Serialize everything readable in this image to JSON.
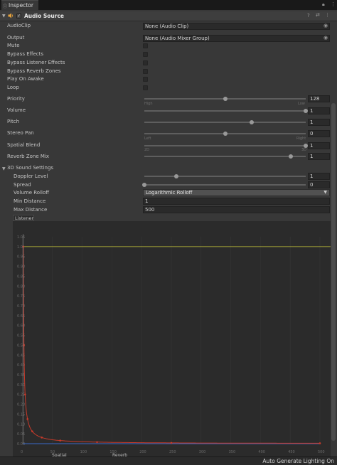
{
  "window": {
    "tab_title": "Inspector"
  },
  "component": {
    "title": "Audio Source",
    "enabled": true
  },
  "fields": {
    "audio_clip": {
      "label": "AudioClip",
      "value": "None (Audio Clip)"
    },
    "output": {
      "label": "Output",
      "value": "None (Audio Mixer Group)"
    },
    "mute": {
      "label": "Mute",
      "checked": false
    },
    "bypass_effects": {
      "label": "Bypass Effects",
      "checked": false
    },
    "bypass_listener_effects": {
      "label": "Bypass Listener Effects",
      "checked": false
    },
    "bypass_reverb_zones": {
      "label": "Bypass Reverb Zones",
      "checked": false
    },
    "play_on_awake": {
      "label": "Play On Awake",
      "checked": false
    },
    "loop": {
      "label": "Loop",
      "checked": false
    },
    "priority": {
      "label": "Priority",
      "value": "128",
      "fraction": 0.5,
      "min_label": "High",
      "max_label": "Low"
    },
    "volume": {
      "label": "Volume",
      "value": "1",
      "fraction": 1.0
    },
    "pitch": {
      "label": "Pitch",
      "value": "1",
      "fraction": 0.667
    },
    "stereo_pan": {
      "label": "Stereo Pan",
      "value": "0",
      "fraction": 0.5,
      "min_label": "Left",
      "max_label": "Right"
    },
    "spatial_blend": {
      "label": "Spatial Blend",
      "value": "1",
      "fraction": 1.0,
      "min_label": "2D",
      "max_label": "3D"
    },
    "reverb_zone_mix": {
      "label": "Reverb Zone Mix",
      "value": "1",
      "fraction": 0.909
    }
  },
  "sound3d": {
    "header": "3D Sound Settings",
    "doppler_level": {
      "label": "Doppler Level",
      "value": "1",
      "fraction": 0.2
    },
    "spread": {
      "label": "Spread",
      "value": "0",
      "fraction": 0.0
    },
    "volume_rolloff": {
      "label": "Volume Rolloff",
      "value": "Logarithmic Rolloff"
    },
    "min_distance": {
      "label": "Min Distance",
      "value": "1"
    },
    "max_distance": {
      "label": "Max Distance",
      "value": "500"
    }
  },
  "curve": {
    "listener_label": "Listener",
    "y_ticks": [
      "1.05",
      "1.0",
      "0.95",
      "0.90",
      "0.85",
      "0.80",
      "0.75",
      "0.70",
      "0.65",
      "0.60",
      "0.55",
      "0.50",
      "0.45",
      "0.40",
      "0.35",
      "0.30",
      "0.25",
      "0.20",
      "0.15",
      "0.10",
      "0.05",
      "0.00"
    ],
    "x_ticks": [
      "0",
      "50",
      "100",
      "150",
      "200",
      "250",
      "300",
      "350",
      "400",
      "450",
      "500"
    ],
    "legend": [
      "Spatial",
      "Reverb"
    ],
    "colors": {
      "rolloff": "#c83a2a",
      "spatial": "#c8c83a",
      "reverb": "#3a6ac8",
      "grid": "#343434"
    }
  },
  "status_bar": {
    "text": "Auto Generate Lighting On"
  }
}
